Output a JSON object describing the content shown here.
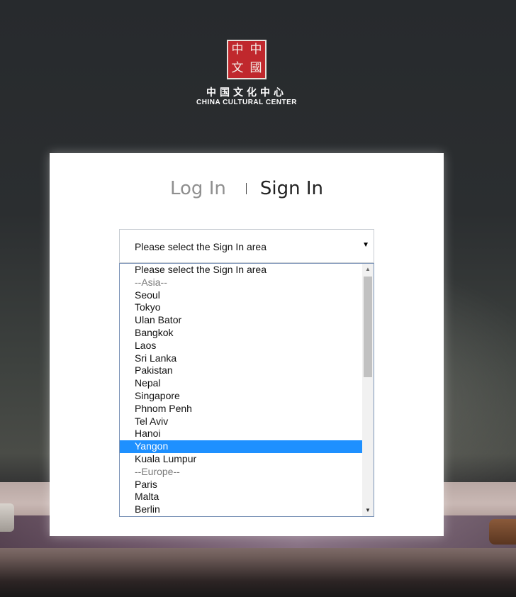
{
  "brand": {
    "logo_glyphs": [
      "中",
      "中",
      "文",
      "國"
    ],
    "name_cn": "中国文化中心",
    "name_en": "CHINA CULTURAL CENTER"
  },
  "tabs": {
    "login": "Log In",
    "signin": "Sign In",
    "active": "signin"
  },
  "select": {
    "value": "Please select the Sign In area"
  },
  "dropdown": {
    "options": [
      "Please select the Sign In area",
      "--Asia--",
      "Seoul",
      "Tokyo",
      "Ulan Bator",
      "Bangkok",
      "Laos",
      "Sri Lanka",
      "Pakistan",
      "Nepal",
      "Singapore",
      "Phnom Penh",
      "Tel Aviv",
      "Hanoi",
      "Yangon",
      "Kuala Lumpur",
      "--Europe--",
      "Paris",
      "Malta",
      "Berlin"
    ],
    "highlighted": "Yangon"
  },
  "icons": {
    "select_arrow": "chevron-down-icon",
    "scroll_up": "scroll-up-arrow-icon",
    "scroll_down": "scroll-down-arrow-icon"
  },
  "colors": {
    "highlight": "#1e90ff",
    "logo_red": "#c0282d"
  }
}
